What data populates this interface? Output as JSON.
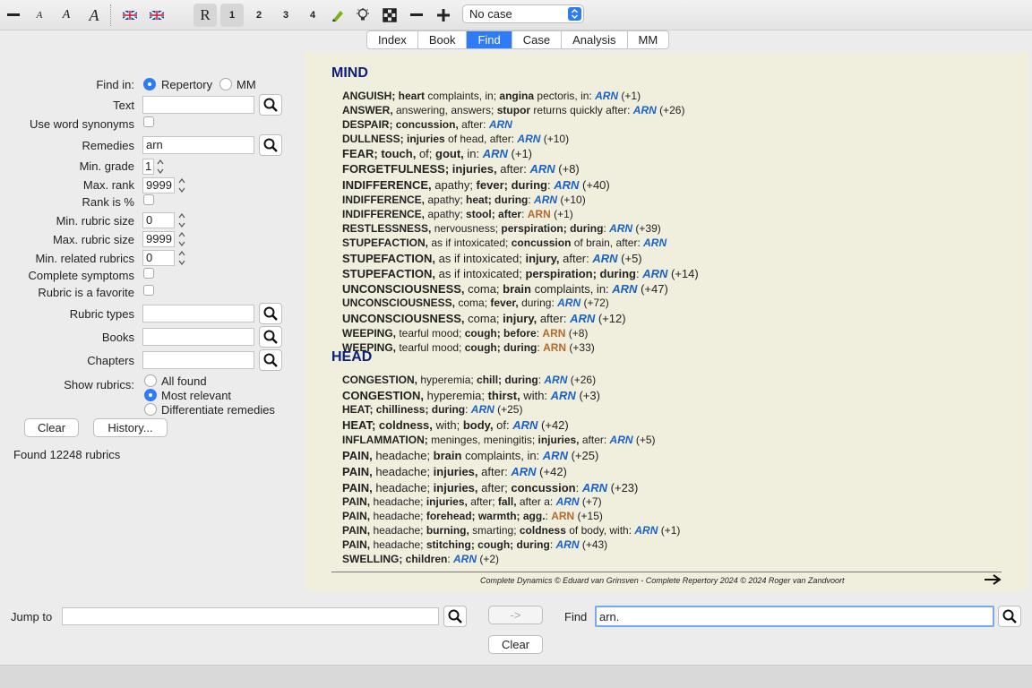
{
  "toolbar": {
    "icons": [
      "minus-icon",
      "small-a-icon",
      "medium-a-icon",
      "large-a-icon",
      "uk-flag-icon",
      "uk-flag-icon",
      "repertory-r-icon",
      "highlighter-icon",
      "bulb-icon",
      "grid-icon",
      "minus-icon",
      "plus-icon"
    ],
    "grade_buttons": [
      "1",
      "2",
      "3",
      "4"
    ],
    "r_label": "R",
    "case_select": "No case"
  },
  "tabs": [
    {
      "label": "Index",
      "active": false
    },
    {
      "label": "Book",
      "active": false
    },
    {
      "label": "Find",
      "active": true
    },
    {
      "label": "Case",
      "active": false
    },
    {
      "label": "Analysis",
      "active": false
    },
    {
      "label": "MM",
      "active": false
    }
  ],
  "form": {
    "find_in_label": "Find in:",
    "find_in_repertory": "Repertory",
    "find_in_mm": "MM",
    "text_label": "Text",
    "text_value": "",
    "use_word_synonyms_label": "Use word synonyms",
    "remedies_label": "Remedies",
    "remedies_value": "arn",
    "min_grade_label": "Min. grade",
    "min_grade_value": "1",
    "max_rank_label": "Max. rank",
    "max_rank_value": "9999",
    "rank_is_pct_label": "Rank is %",
    "min_rubric_size_label": "Min. rubric size",
    "min_rubric_size_value": "0",
    "max_rubric_size_label": "Max. rubric size",
    "max_rubric_size_value": "9999",
    "min_related_label": "Min. related rubrics",
    "min_related_value": "0",
    "complete_symptoms_label": "Complete symptoms",
    "favorite_label": "Rubric is a favorite",
    "rubric_types_label": "Rubric types",
    "books_label": "Books",
    "chapters_label": "Chapters",
    "show_rubrics_label": "Show rubrics:",
    "show_all_found": "All found",
    "show_most_relevant": "Most relevant",
    "show_differentiate": "Differentiate remedies",
    "clear_button": "Clear",
    "history_button": "History...",
    "found_text": "Found 12248 rubrics"
  },
  "results": {
    "chapters": [
      {
        "name": "MIND",
        "rubrics": [
          {
            "big": false,
            "parts": [
              [
                "b",
                "ANGUISH; heart"
              ],
              [
                "n",
                " complaints, in; "
              ],
              [
                "b",
                "angina"
              ],
              [
                "n",
                " pectoris, in: "
              ],
              [
                "r",
                "ARN"
              ],
              [
                "n",
                " (+1)"
              ]
            ]
          },
          {
            "big": false,
            "parts": [
              [
                "b",
                "ANSWER,"
              ],
              [
                "n",
                " answering, answers; "
              ],
              [
                "b",
                "stupor"
              ],
              [
                "n",
                " returns quickly after: "
              ],
              [
                "r",
                "ARN"
              ],
              [
                "n",
                " (+26)"
              ]
            ]
          },
          {
            "big": false,
            "parts": [
              [
                "b",
                "DESPAIR; concussion,"
              ],
              [
                "n",
                " after: "
              ],
              [
                "r",
                "ARN"
              ]
            ]
          },
          {
            "big": false,
            "parts": [
              [
                "b",
                "DULLNESS; injuries"
              ],
              [
                "n",
                " of head, after: "
              ],
              [
                "r",
                "ARN"
              ],
              [
                "n",
                " (+10)"
              ]
            ]
          },
          {
            "big": true,
            "parts": [
              [
                "b",
                "FEAR; touch,"
              ],
              [
                "n",
                " of; "
              ],
              [
                "b",
                "gout,"
              ],
              [
                "n",
                " in: "
              ],
              [
                "r",
                "ARN"
              ],
              [
                "n",
                " (+1)"
              ]
            ]
          },
          {
            "big": true,
            "parts": [
              [
                "b",
                "FORGETFULNESS; injuries,"
              ],
              [
                "n",
                " after: "
              ],
              [
                "r",
                "ARN"
              ],
              [
                "n",
                " (+8)"
              ]
            ]
          },
          {
            "big": true,
            "parts": [
              [
                "b",
                "INDIFFERENCE,"
              ],
              [
                "n",
                " apathy; "
              ],
              [
                "b",
                "fever; during"
              ],
              [
                "n",
                ": "
              ],
              [
                "r",
                "ARN"
              ],
              [
                "n",
                " (+40)"
              ]
            ]
          },
          {
            "big": false,
            "parts": [
              [
                "b",
                "INDIFFERENCE,"
              ],
              [
                "n",
                " apathy; "
              ],
              [
                "b",
                "heat; during"
              ],
              [
                "n",
                ": "
              ],
              [
                "r",
                "ARN"
              ],
              [
                "n",
                " (+10)"
              ]
            ]
          },
          {
            "big": false,
            "parts": [
              [
                "b",
                "INDIFFERENCE,"
              ],
              [
                "n",
                " apathy; "
              ],
              [
                "b",
                "stool; after"
              ],
              [
                "n",
                ": "
              ],
              [
                "o",
                "ARN"
              ],
              [
                "n",
                " (+1)"
              ]
            ]
          },
          {
            "big": false,
            "parts": [
              [
                "b",
                "RESTLESSNESS,"
              ],
              [
                "n",
                " nervousness; "
              ],
              [
                "b",
                "perspiration; during"
              ],
              [
                "n",
                ": "
              ],
              [
                "r",
                "ARN"
              ],
              [
                "n",
                " (+39)"
              ]
            ]
          },
          {
            "big": false,
            "parts": [
              [
                "b",
                "STUPEFACTION,"
              ],
              [
                "n",
                " as if intoxicated; "
              ],
              [
                "b",
                "concussion"
              ],
              [
                "n",
                " of brain, after: "
              ],
              [
                "r",
                "ARN"
              ]
            ]
          },
          {
            "big": true,
            "parts": [
              [
                "b",
                "STUPEFACTION,"
              ],
              [
                "n",
                " as if intoxicated; "
              ],
              [
                "b",
                "injury,"
              ],
              [
                "n",
                " after: "
              ],
              [
                "r",
                "ARN"
              ],
              [
                "n",
                " (+5)"
              ]
            ]
          },
          {
            "big": true,
            "parts": [
              [
                "b",
                "STUPEFACTION,"
              ],
              [
                "n",
                " as if intoxicated; "
              ],
              [
                "b",
                "perspiration; during"
              ],
              [
                "n",
                ": "
              ],
              [
                "r",
                "ARN"
              ],
              [
                "n",
                " (+14)"
              ]
            ]
          },
          {
            "big": true,
            "parts": [
              [
                "b",
                "UNCONSCIOUSNESS,"
              ],
              [
                "n",
                " coma; "
              ],
              [
                "b",
                "brain"
              ],
              [
                "n",
                " complaints, in: "
              ],
              [
                "r",
                "ARN"
              ],
              [
                "n",
                " (+47)"
              ]
            ]
          },
          {
            "big": false,
            "parts": [
              [
                "b",
                "UNCONSCIOUSNESS,"
              ],
              [
                "n",
                " coma; "
              ],
              [
                "b",
                "fever,"
              ],
              [
                "n",
                " during: "
              ],
              [
                "r",
                "ARN"
              ],
              [
                "n",
                " (+72)"
              ]
            ]
          },
          {
            "big": true,
            "parts": [
              [
                "b",
                "UNCONSCIOUSNESS,"
              ],
              [
                "n",
                " coma; "
              ],
              [
                "b",
                "injury,"
              ],
              [
                "n",
                " after: "
              ],
              [
                "r",
                "ARN"
              ],
              [
                "n",
                " (+12)"
              ]
            ]
          },
          {
            "big": false,
            "parts": [
              [
                "b",
                "WEEPING,"
              ],
              [
                "n",
                " tearful mood; "
              ],
              [
                "b",
                "cough; before"
              ],
              [
                "n",
                ": "
              ],
              [
                "o",
                "ARN"
              ],
              [
                "n",
                " (+8)"
              ]
            ]
          },
          {
            "big": false,
            "parts": [
              [
                "b",
                "WEEPING,"
              ],
              [
                "n",
                " tearful mood; "
              ],
              [
                "b",
                "cough; during"
              ],
              [
                "n",
                ": "
              ],
              [
                "o",
                "ARN"
              ],
              [
                "n",
                " (+33)"
              ]
            ]
          }
        ]
      },
      {
        "name": "HEAD",
        "rubrics": [
          {
            "big": false,
            "parts": [
              [
                "b",
                "CONGESTION,"
              ],
              [
                "n",
                " hyperemia; "
              ],
              [
                "b",
                "chill; during"
              ],
              [
                "n",
                ": "
              ],
              [
                "r",
                "ARN"
              ],
              [
                "n",
                " (+26)"
              ]
            ]
          },
          {
            "big": true,
            "parts": [
              [
                "b",
                "CONGESTION,"
              ],
              [
                "n",
                " hyperemia; "
              ],
              [
                "b",
                "thirst,"
              ],
              [
                "n",
                " with: "
              ],
              [
                "r",
                "ARN"
              ],
              [
                "n",
                " (+3)"
              ]
            ]
          },
          {
            "big": false,
            "parts": [
              [
                "b",
                "HEAT; chilliness; during"
              ],
              [
                "n",
                ": "
              ],
              [
                "r",
                "ARN"
              ],
              [
                "n",
                " (+25)"
              ]
            ]
          },
          {
            "big": true,
            "parts": [
              [
                "b",
                "HEAT; coldness,"
              ],
              [
                "n",
                " with; "
              ],
              [
                "b",
                "body,"
              ],
              [
                "n",
                " of: "
              ],
              [
                "r",
                "ARN"
              ],
              [
                "n",
                " (+42)"
              ]
            ]
          },
          {
            "big": false,
            "parts": [
              [
                "b",
                "INFLAMMATION;"
              ],
              [
                "n",
                " meninges, meningitis; "
              ],
              [
                "b",
                "injuries,"
              ],
              [
                "n",
                " after: "
              ],
              [
                "r",
                "ARN"
              ],
              [
                "n",
                " (+5)"
              ]
            ]
          },
          {
            "big": true,
            "parts": [
              [
                "b",
                "PAIN,"
              ],
              [
                "n",
                " headache; "
              ],
              [
                "b",
                "brain"
              ],
              [
                "n",
                " complaints, in: "
              ],
              [
                "r",
                "ARN"
              ],
              [
                "n",
                " (+25)"
              ]
            ]
          },
          {
            "big": true,
            "parts": [
              [
                "b",
                "PAIN,"
              ],
              [
                "n",
                " headache; "
              ],
              [
                "b",
                "injuries,"
              ],
              [
                "n",
                " after: "
              ],
              [
                "r",
                "ARN"
              ],
              [
                "n",
                " (+42)"
              ]
            ]
          },
          {
            "big": true,
            "parts": [
              [
                "b",
                "PAIN,"
              ],
              [
                "n",
                " headache; "
              ],
              [
                "b",
                "injuries,"
              ],
              [
                "n",
                " after; "
              ],
              [
                "b",
                "concussion"
              ],
              [
                "n",
                ": "
              ],
              [
                "r",
                "ARN"
              ],
              [
                "n",
                " (+23)"
              ]
            ]
          },
          {
            "big": false,
            "parts": [
              [
                "b",
                "PAIN,"
              ],
              [
                "n",
                " headache; "
              ],
              [
                "b",
                "injuries,"
              ],
              [
                "n",
                " after; "
              ],
              [
                "b",
                "fall,"
              ],
              [
                "n",
                " after a: "
              ],
              [
                "r",
                "ARN"
              ],
              [
                "n",
                " (+7)"
              ]
            ]
          },
          {
            "big": false,
            "parts": [
              [
                "b",
                "PAIN,"
              ],
              [
                "n",
                " headache; "
              ],
              [
                "b",
                "forehead; warmth; agg."
              ],
              [
                "n",
                ": "
              ],
              [
                "o",
                "ARN"
              ],
              [
                "n",
                " (+15)"
              ]
            ]
          },
          {
            "big": false,
            "parts": [
              [
                "b",
                "PAIN,"
              ],
              [
                "n",
                " headache; "
              ],
              [
                "b",
                "burning,"
              ],
              [
                "n",
                " smarting; "
              ],
              [
                "b",
                "coldness"
              ],
              [
                "n",
                " of body, with: "
              ],
              [
                "r",
                "ARN"
              ],
              [
                "n",
                " (+1)"
              ]
            ]
          },
          {
            "big": false,
            "parts": [
              [
                "b",
                "PAIN,"
              ],
              [
                "n",
                " headache; "
              ],
              [
                "b",
                "stitching; cough; during"
              ],
              [
                "n",
                ": "
              ],
              [
                "r",
                "ARN"
              ],
              [
                "n",
                " (+43)"
              ]
            ]
          },
          {
            "big": false,
            "parts": [
              [
                "b",
                "SWELLING; children"
              ],
              [
                "n",
                ": "
              ],
              [
                "r",
                "ARN"
              ],
              [
                "n",
                " (+2)"
              ]
            ]
          }
        ]
      }
    ],
    "footer": "Complete Dynamics © Eduard van Grinsven   -   Complete Repertory 2024 © 2024 Roger van Zandvoort"
  },
  "bottom": {
    "jump_to_label": "Jump to",
    "jump_to_value": "",
    "go_button": "->",
    "find_label": "Find",
    "find_value": "arn.",
    "clear_button": "Clear"
  },
  "colors": {
    "accent": "#2f7bf5",
    "content_bg": "#f0efdd",
    "chapter": "#0a1f7a",
    "remedy": "#1a62c8",
    "remedy_low": "#b36a2c"
  }
}
